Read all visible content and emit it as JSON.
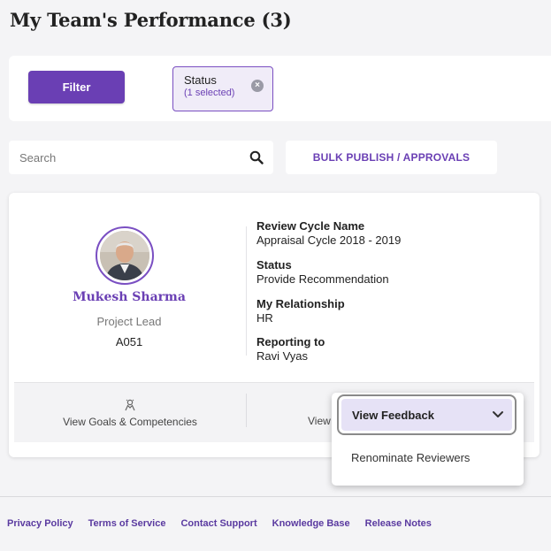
{
  "page": {
    "title": "My Team's Performance (3)"
  },
  "filters": {
    "filter_button": "Filter",
    "status_chip": {
      "label": "Status",
      "count": "(1 selected)"
    }
  },
  "search": {
    "placeholder": "Search"
  },
  "actions": {
    "bulk_label": "BULK PUBLISH / APPROVALS"
  },
  "employee": {
    "name": "Mukesh Sharma",
    "role": "Project Lead",
    "id": "A051",
    "details": [
      {
        "label": "Review Cycle Name",
        "value": "Appraisal Cycle 2018 - 2019"
      },
      {
        "label": "Status",
        "value": "Provide Recommendation"
      },
      {
        "label": "My Relationship",
        "value": "HR"
      },
      {
        "label": "Reporting to",
        "value": "Ravi Vyas"
      }
    ],
    "footer": {
      "goals_label": "View Goals & Competencies",
      "feedback_partial": "View"
    }
  },
  "dropdown": {
    "selected": "View Feedback",
    "options": [
      "Renominate Reviewers"
    ]
  },
  "footer_links": [
    "Privacy Policy",
    "Terms of Service",
    "Contact Support",
    "Knowledge Base",
    "Release Notes"
  ],
  "colors": {
    "accent": "#6a3fb4",
    "chip_bg": "#f0ecf8",
    "menu_highlight": "#e6e2f6"
  }
}
